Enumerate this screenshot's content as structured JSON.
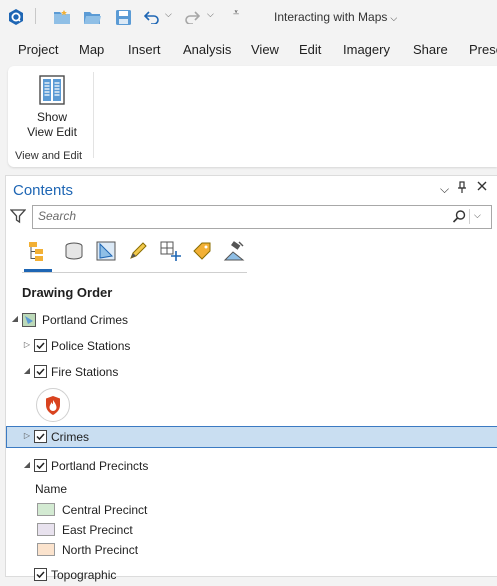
{
  "titlebar": {
    "title": "Interacting with Maps"
  },
  "menu": [
    "Project",
    "Map",
    "Insert",
    "Analysis",
    "View",
    "Edit",
    "Imagery",
    "Share",
    "Prese"
  ],
  "ribbon": {
    "button_label_line1": "Show",
    "button_label_line2": "View Edit",
    "group_label": "View and Edit"
  },
  "contents": {
    "title": "Contents",
    "search_placeholder": "Search",
    "section_title": "Drawing Order",
    "map_name": "Portland Crimes",
    "layers": {
      "police": "Police Stations",
      "fire": "Fire Stations",
      "crimes": "Crimes",
      "precincts": "Portland Precincts",
      "topographic": "Topographic"
    },
    "legend": {
      "heading": "Name",
      "items": [
        {
          "label": "Central Precinct",
          "color": "#d3ead2"
        },
        {
          "label": "East Precinct",
          "color": "#e8e2ee"
        },
        {
          "label": "North Precinct",
          "color": "#fbe3cd"
        }
      ]
    }
  },
  "colors": {
    "accent": "#1e66b4",
    "selection": "#c9def1",
    "fire_symbol": "#d9431f"
  }
}
